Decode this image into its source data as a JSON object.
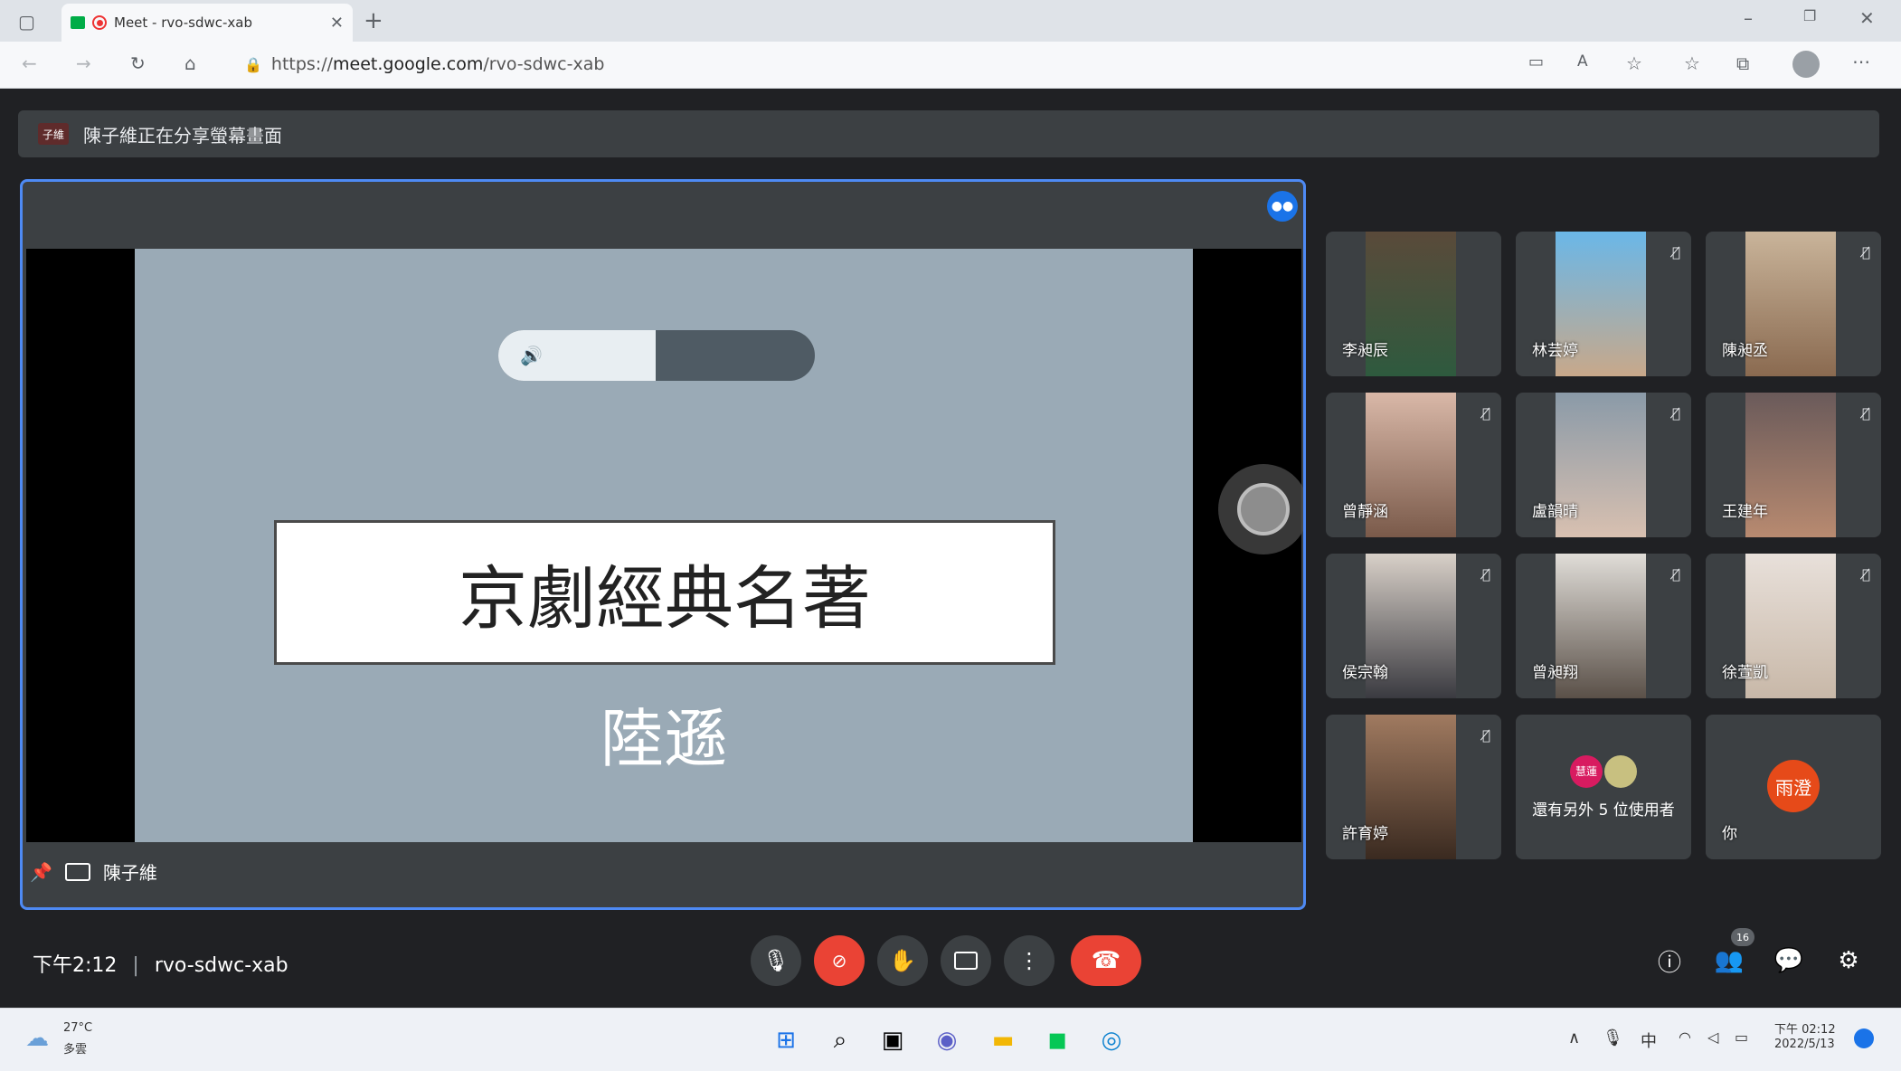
{
  "browser": {
    "tab_title": "Meet - rvo-sdwc-xab",
    "url_prefix": "https://",
    "url_host": "meet.google.com",
    "url_path": "/rvo-sdwc-xab"
  },
  "banner": {
    "avatar_text": "子維",
    "text": "陳子維正在分享螢幕畫面"
  },
  "presentation": {
    "title": "京劇經典名著",
    "subtitle": "陸遜",
    "presenter": "陳子維",
    "toggle_icon": "🔊"
  },
  "participants": [
    {
      "name": "李昶辰",
      "muted": false
    },
    {
      "name": "林芸婷",
      "muted": true
    },
    {
      "name": "陳昶丞",
      "muted": true
    },
    {
      "name": "曾靜涵",
      "muted": true
    },
    {
      "name": "盧韻晴",
      "muted": true
    },
    {
      "name": "王建年",
      "muted": true
    },
    {
      "name": "侯宗翰",
      "muted": true
    },
    {
      "name": "曾昶翔",
      "muted": true
    },
    {
      "name": "徐萱凱",
      "muted": true
    },
    {
      "name": "許育婷",
      "muted": true
    }
  ],
  "others_tile": {
    "avatar_text": "慧蓮",
    "label": "還有另外 5 位使用者"
  },
  "self_tile": {
    "avatar_text": "雨澄",
    "label": "你"
  },
  "meeting_info": {
    "time": "下午2:12",
    "separator": "|",
    "code": "rvo-sdwc-xab"
  },
  "people_badge": "16",
  "taskbar": {
    "weather_temp": "27°C",
    "weather_desc": "多雲",
    "ime": "中",
    "time": "下午 02:12",
    "date": "2022/5/13"
  },
  "colors": {
    "accent": "#1a73e8",
    "danger": "#ea4335",
    "tile_bg": "#3c4043"
  }
}
